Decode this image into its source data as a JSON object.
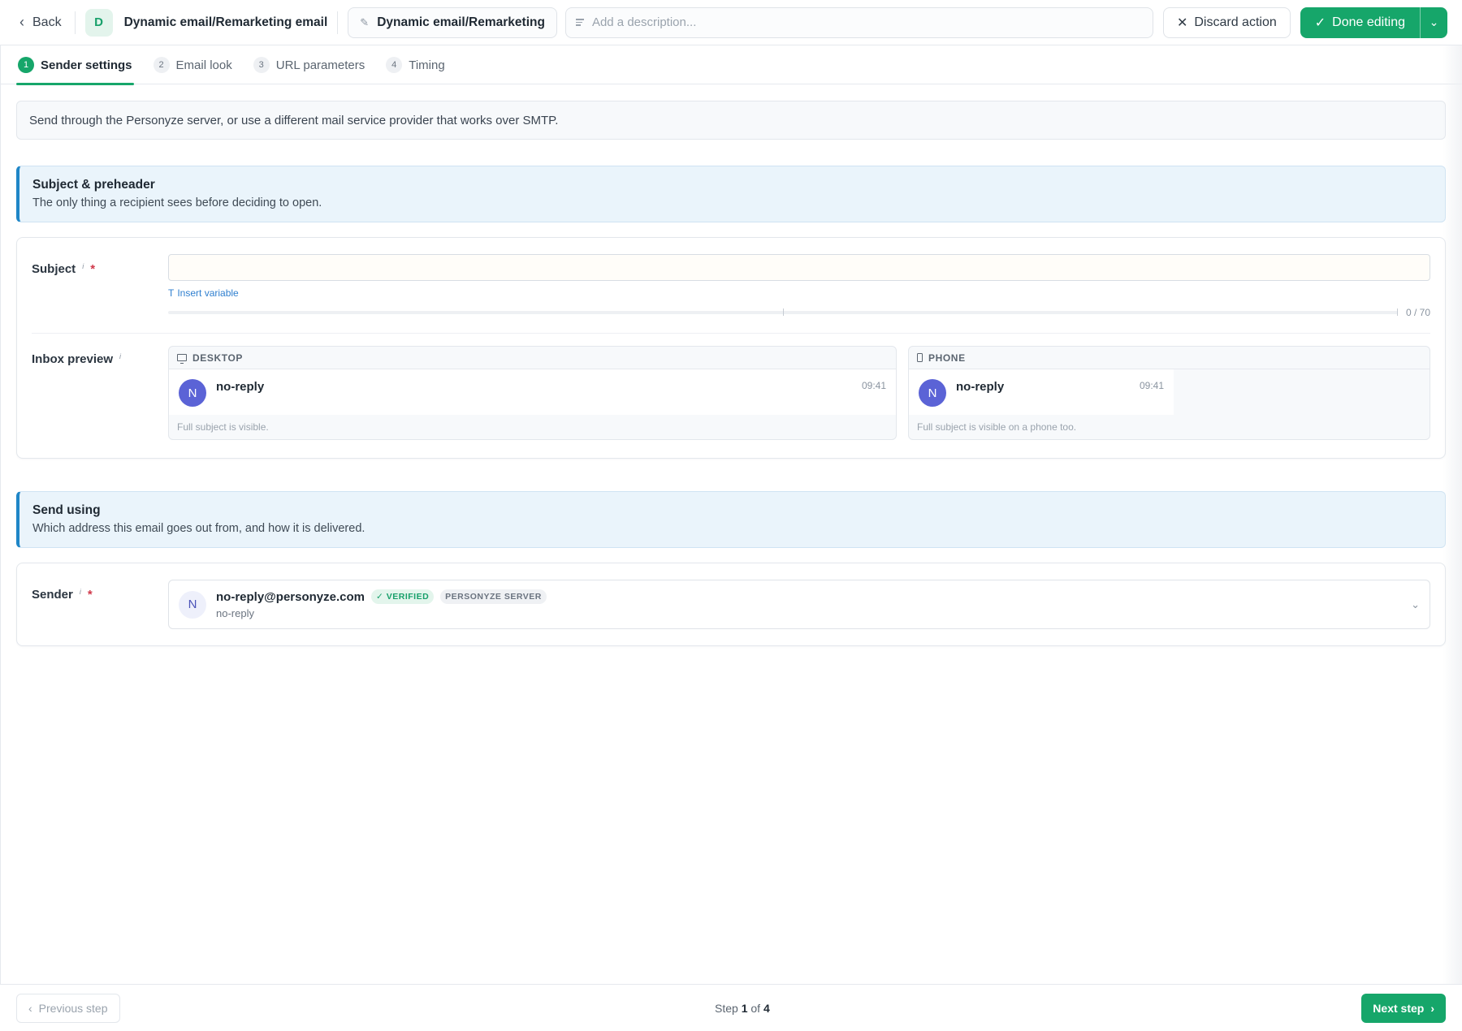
{
  "header": {
    "back_label": "Back",
    "avatar_letter": "D",
    "title": "Dynamic email/Remarketing email",
    "name_value": "Dynamic email/Remarketing",
    "description_placeholder": "Add a description...",
    "discard_label": "Discard action",
    "done_label": "Done editing"
  },
  "tabs": [
    {
      "num": "1",
      "label": "Sender settings",
      "active": true
    },
    {
      "num": "2",
      "label": "Email look",
      "active": false
    },
    {
      "num": "3",
      "label": "URL parameters",
      "active": false
    },
    {
      "num": "4",
      "label": "Timing",
      "active": false
    }
  ],
  "notice": "Send through the Personyze server, or use a different mail service provider that works over SMTP.",
  "subject_section": {
    "heading": "Subject & preheader",
    "subheading": "The only thing a recipient sees before deciding to open.",
    "subject_label": "Subject",
    "subject_value": "",
    "insert_variable": "Insert variable",
    "counter": "0 / 70",
    "inbox_label": "Inbox preview",
    "desktop": {
      "header": "DESKTOP",
      "avatar": "N",
      "from": "no-reply",
      "time": "09:41",
      "note": "Full subject is visible."
    },
    "phone": {
      "header": "PHONE",
      "avatar": "N",
      "from": "no-reply",
      "time": "09:41",
      "note": "Full subject is visible on a phone too."
    }
  },
  "send_section": {
    "heading": "Send using",
    "subheading": "Which address this email goes out from, and how it is delivered.",
    "sender_label": "Sender",
    "sender_avatar": "N",
    "sender_email": "no-reply@personyze.com",
    "badge_verified": "VERIFIED",
    "badge_server": "PERSONYZE SERVER",
    "sender_name": "no-reply"
  },
  "footer": {
    "prev_label": "Previous step",
    "step_prefix": "Step",
    "step_current": "1",
    "step_of": "of",
    "step_total": "4",
    "next_label": "Next step"
  },
  "colors": {
    "accent": "#16a66a",
    "info_border": "#1f86c7",
    "required": "#d0384a"
  }
}
